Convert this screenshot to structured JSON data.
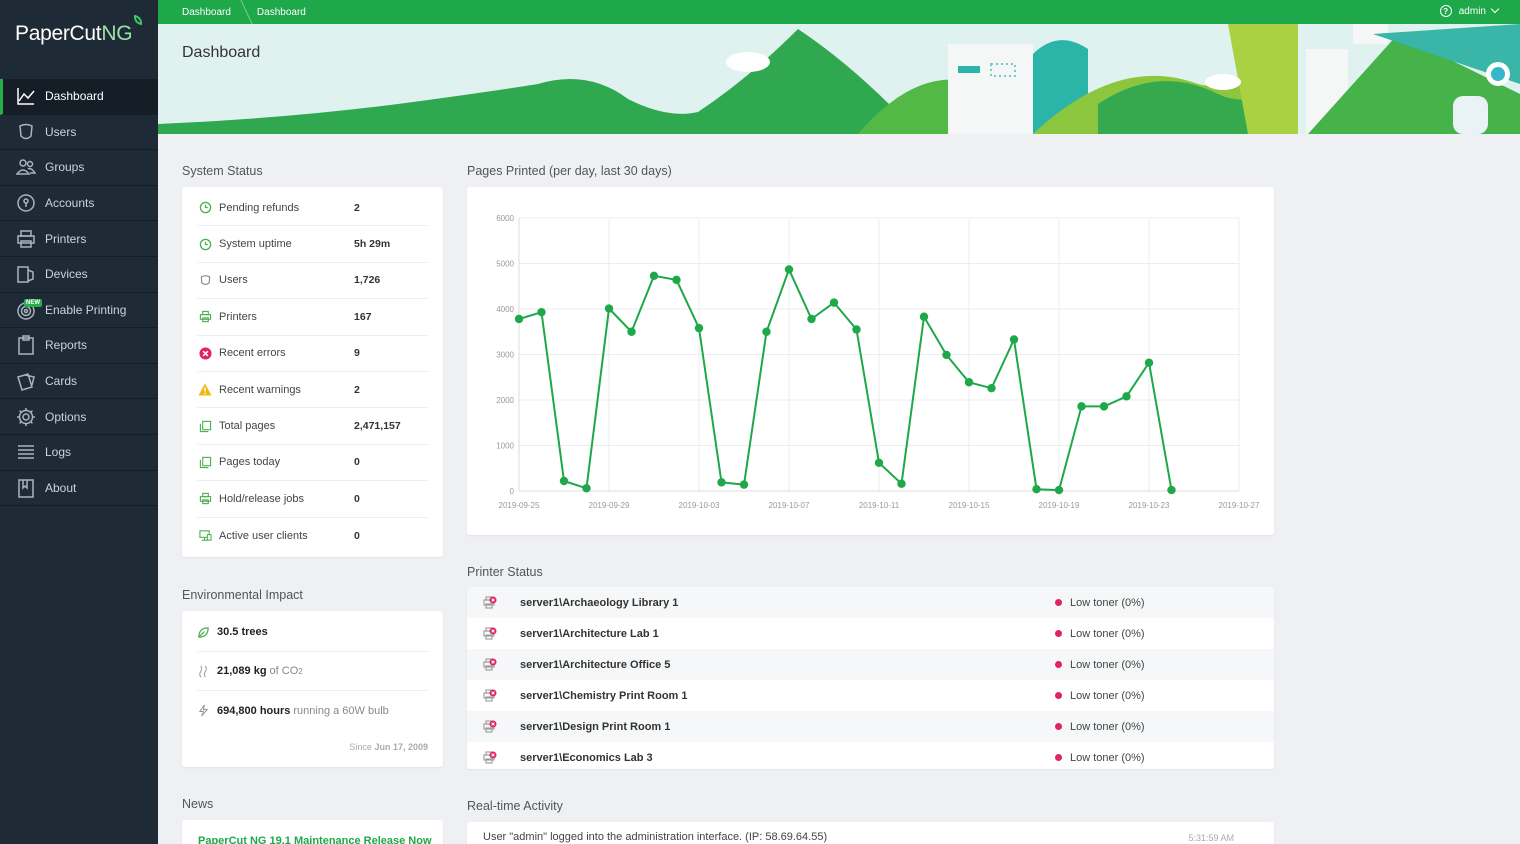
{
  "sidebar": {
    "logo_main": "PaperCut",
    "logo_suffix": "NG",
    "items": [
      {
        "label": "Dashboard"
      },
      {
        "label": "Users"
      },
      {
        "label": "Groups"
      },
      {
        "label": "Accounts"
      },
      {
        "label": "Printers"
      },
      {
        "label": "Devices"
      },
      {
        "label": "Enable Printing",
        "badge": "NEW"
      },
      {
        "label": "Reports"
      },
      {
        "label": "Cards"
      },
      {
        "label": "Options"
      },
      {
        "label": "Logs"
      },
      {
        "label": "About"
      }
    ]
  },
  "topbar": {
    "breadcrumbs": [
      "Dashboard",
      "Dashboard"
    ],
    "user": "admin"
  },
  "page": {
    "title": "Dashboard"
  },
  "system_status": {
    "title": "System Status",
    "rows": [
      {
        "label": "Pending refunds",
        "value": "2"
      },
      {
        "label": "System uptime",
        "value": "5h 29m"
      },
      {
        "label": "Users",
        "value": "1,726"
      },
      {
        "label": "Printers",
        "value": "167"
      },
      {
        "label": "Recent errors",
        "value": "9"
      },
      {
        "label": "Recent warnings",
        "value": "2"
      },
      {
        "label": "Total pages",
        "value": "2,471,157"
      },
      {
        "label": "Pages today",
        "value": "0"
      },
      {
        "label": "Hold/release jobs",
        "value": "0"
      },
      {
        "label": "Active user clients",
        "value": "0"
      }
    ]
  },
  "environmental_impact": {
    "title": "Environmental Impact",
    "trees": "30.5 trees",
    "co2_value": "21,089 kg",
    "co2_suffix": "of CO",
    "co2_sub": "2",
    "bulb_value": "694,800 hours",
    "bulb_suffix": "running a 60W bulb",
    "since_label": "Since",
    "since_date": "Jun 17, 2009"
  },
  "news": {
    "title": "News",
    "headline": "PaperCut NG 19.1 Maintenance Release Now"
  },
  "pages_printed": {
    "title": "Pages Printed (per day, last 30 days)"
  },
  "chart_data": {
    "type": "line",
    "title": "Pages Printed (per day, last 30 days)",
    "x": [
      "2019-09-25",
      "2019-09-26",
      "2019-09-27",
      "2019-09-28",
      "2019-09-29",
      "2019-09-30",
      "2019-10-01",
      "2019-10-02",
      "2019-10-03",
      "2019-10-04",
      "2019-10-05",
      "2019-10-06",
      "2019-10-07",
      "2019-10-08",
      "2019-10-09",
      "2019-10-10",
      "2019-10-11",
      "2019-10-12",
      "2019-10-13",
      "2019-10-14",
      "2019-10-15",
      "2019-10-16",
      "2019-10-17",
      "2019-10-18",
      "2019-10-19",
      "2019-10-20",
      "2019-10-21",
      "2019-10-22",
      "2019-10-23",
      "2019-10-24"
    ],
    "series": [
      {
        "values": [
          3780,
          3930,
          220,
          60,
          4010,
          3500,
          4730,
          4640,
          3580,
          190,
          140,
          3500,
          4870,
          3780,
          4140,
          3550,
          620,
          160,
          3830,
          2990,
          2390,
          2260,
          3330,
          40,
          20,
          1860,
          1860,
          2080,
          2820,
          20
        ]
      }
    ],
    "x_ticks": [
      "2019-09-25",
      "2019-09-29",
      "2019-10-03",
      "2019-10-07",
      "2019-10-11",
      "2019-10-15",
      "2019-10-19",
      "2019-10-23",
      "2019-10-27"
    ],
    "y_ticks": [
      0,
      1000,
      2000,
      3000,
      4000,
      5000,
      6000
    ],
    "ylim": [
      0,
      6000
    ],
    "xlim": [
      "2019-09-25",
      "2019-10-27"
    ],
    "grid": true,
    "color": "#1ea84a",
    "xlabel": "",
    "ylabel": ""
  },
  "printer_status": {
    "title": "Printer Status",
    "rows": [
      {
        "name": "server1\\Archaeology Library 1",
        "status": "Low toner (0%)"
      },
      {
        "name": "server1\\Architecture Lab 1",
        "status": "Low toner (0%)"
      },
      {
        "name": "server1\\Architecture Office 5",
        "status": "Low toner (0%)"
      },
      {
        "name": "server1\\Chemistry Print Room 1",
        "status": "Low toner (0%)"
      },
      {
        "name": "server1\\Design Print Room 1",
        "status": "Low toner (0%)"
      },
      {
        "name": "server1\\Economics Lab 3",
        "status": "Low toner (0%)"
      }
    ]
  },
  "realtime_activity": {
    "title": "Real-time Activity",
    "message": "User \"admin\" logged into the administration interface. (IP: 58.69.64.55)",
    "time": "5:31:59 AM"
  },
  "colors": {
    "brand_green": "#1ea84a",
    "sidebar_bg": "#1f2a37",
    "error_red": "#e0245e",
    "warning_yellow": "#f5b70f"
  }
}
